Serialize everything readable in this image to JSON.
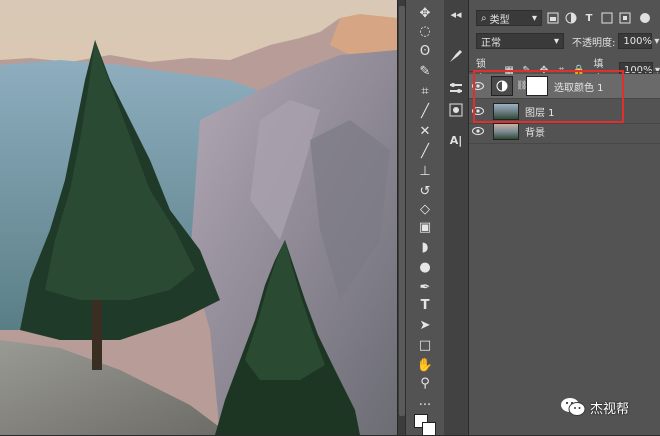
{
  "tools": [
    {
      "name": "move-tool-icon",
      "glyph": "✥"
    },
    {
      "name": "elliptical-marquee-icon",
      "glyph": "◌"
    },
    {
      "name": "lasso-icon",
      "glyph": "ʘ"
    },
    {
      "name": "quick-select-icon",
      "glyph": "✎"
    },
    {
      "name": "crop-icon",
      "glyph": "⌗"
    },
    {
      "name": "eyedropper-icon",
      "glyph": "╱"
    },
    {
      "name": "healing-brush-icon",
      "glyph": "✕"
    },
    {
      "name": "brush-icon",
      "glyph": "╱"
    },
    {
      "name": "clone-stamp-icon",
      "glyph": "⊥"
    },
    {
      "name": "history-brush-icon",
      "glyph": "↺"
    },
    {
      "name": "eraser-icon",
      "glyph": "◇"
    },
    {
      "name": "gradient-icon",
      "glyph": "▣"
    },
    {
      "name": "blur-icon",
      "glyph": "◗"
    },
    {
      "name": "dodge-icon",
      "glyph": "●"
    },
    {
      "name": "pen-icon",
      "glyph": "✒"
    },
    {
      "name": "type-tool-icon",
      "glyph": "T"
    },
    {
      "name": "path-select-icon",
      "glyph": "➤"
    },
    {
      "name": "rectangle-icon",
      "glyph": "□"
    },
    {
      "name": "hand-icon",
      "glyph": "✋"
    },
    {
      "name": "zoom-icon",
      "glyph": "⚲"
    },
    {
      "name": "more-tools-icon",
      "glyph": "···"
    }
  ],
  "panel": {
    "filter_label": "类型",
    "blend_mode": "正常",
    "opacity_label": "不透明度:",
    "opacity_value": "100%",
    "lock_label": "锁定:",
    "fill_label": "填充:",
    "fill_value": "100%"
  },
  "layers": [
    {
      "name": "选取颜色 1",
      "kind": "adjustment",
      "selected": true
    },
    {
      "name": "图层 1",
      "kind": "image",
      "selected": false
    },
    {
      "name": "背景",
      "kind": "image",
      "selected": false
    }
  ],
  "midstrip": {
    "paragraph_label": "A|"
  },
  "watermark": {
    "text": "杰视帮"
  },
  "colors": {
    "highlight": "#e0302e",
    "panel_bg": "#535353",
    "selected_row": "#6a6a6a"
  }
}
